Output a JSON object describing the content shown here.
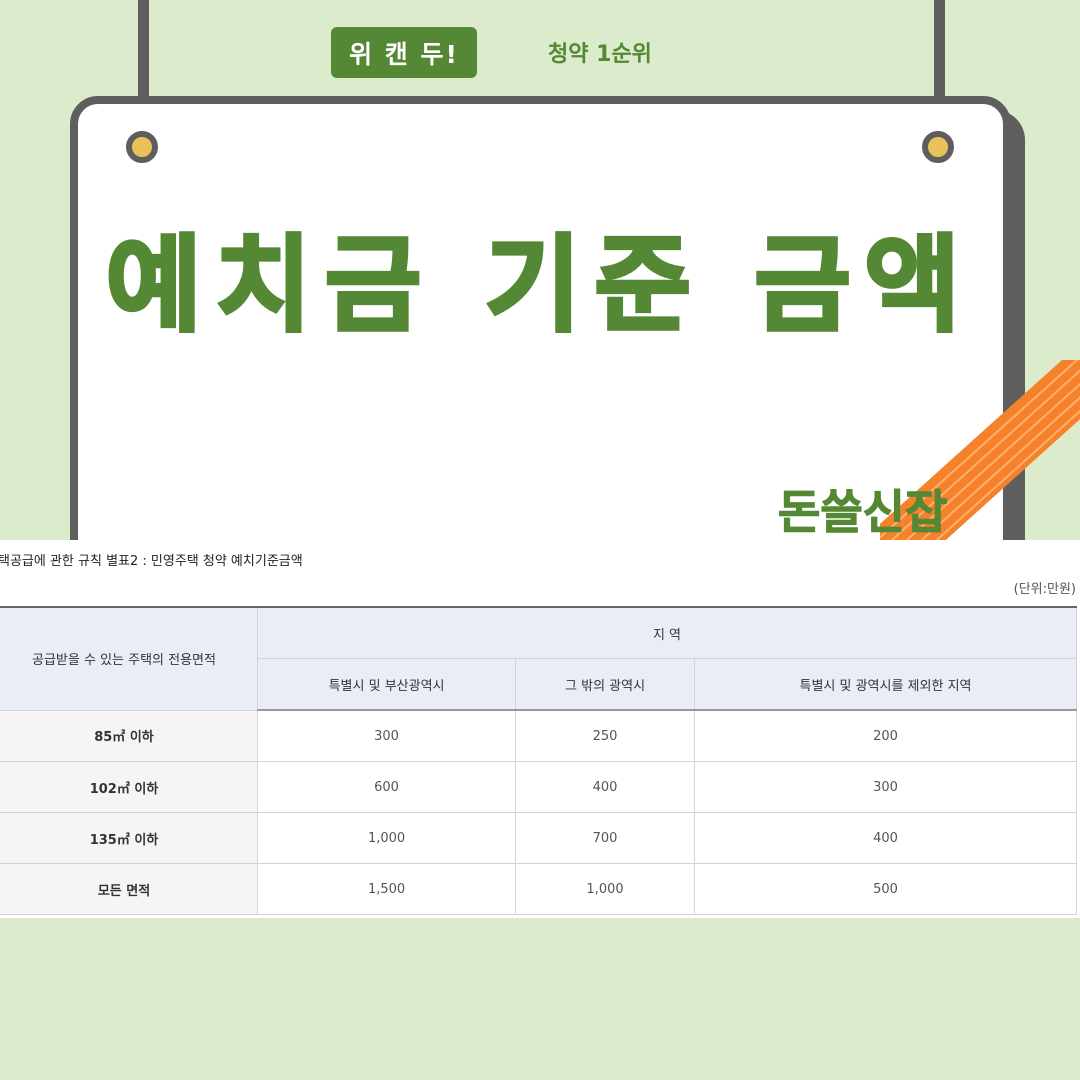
{
  "header": {
    "badge": "위 캔 두!",
    "subtitle": "청약 1순위"
  },
  "board": {
    "title": "예치금 기준 금액",
    "brand": "돈쓸신잡"
  },
  "colors": {
    "background": "#dcebcc",
    "accent_green": "#548834",
    "stripe_orange": "#f5822a",
    "frame_gray": "#5e5e5e"
  },
  "table": {
    "caption": "택공급에 관한 규칙 별표2 : 민영주택 청약 예치기준금액",
    "unit": "(단위:만원)",
    "area_header": "공급받을 수 있는 주택의 전용면적",
    "region_header": "지 역",
    "columns": [
      "특별시 및 부산광역시",
      "그 밖의 광역시",
      "특별시 및 광역시를 제외한 지역"
    ],
    "rows": [
      {
        "area": "85㎡ 이하",
        "values": [
          "300",
          "250",
          "200"
        ]
      },
      {
        "area": "102㎡ 이하",
        "values": [
          "600",
          "400",
          "300"
        ]
      },
      {
        "area": "135㎡ 이하",
        "values": [
          "1,000",
          "700",
          "400"
        ]
      },
      {
        "area": "모든 면적",
        "values": [
          "1,500",
          "1,000",
          "500"
        ]
      }
    ]
  }
}
